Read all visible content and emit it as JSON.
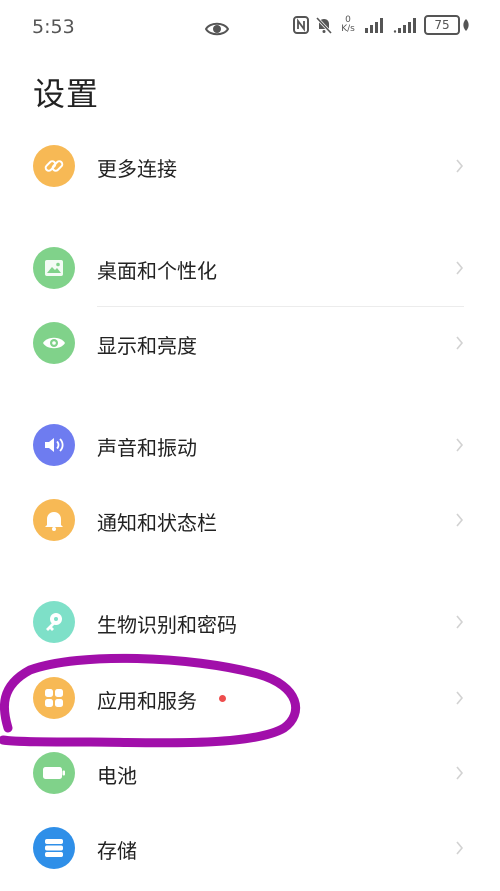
{
  "status": {
    "time": "5:53",
    "net_speed_value": "0",
    "net_speed_unit": "K/s",
    "battery_level": "75"
  },
  "page": {
    "title": "设置"
  },
  "settings": {
    "items": [
      {
        "label": "更多连接",
        "icon": "link-icon",
        "color": "#F7B955"
      },
      {
        "label": "桌面和个性化",
        "icon": "wallpaper-icon",
        "color": "#80D28A"
      },
      {
        "label": "显示和亮度",
        "icon": "eye-icon",
        "color": "#80D28A"
      },
      {
        "label": "声音和振动",
        "icon": "speaker-icon",
        "color": "#6E7CF0"
      },
      {
        "label": "通知和状态栏",
        "icon": "bell-icon",
        "color": "#F7B955"
      },
      {
        "label": "生物识别和密码",
        "icon": "key-icon",
        "color": "#7EE0C8"
      },
      {
        "label": "应用和服务",
        "icon": "apps-grid-icon",
        "color": "#F7B955",
        "badge": true
      },
      {
        "label": "电池",
        "icon": "battery-icon",
        "color": "#80D28A"
      },
      {
        "label": "存储",
        "icon": "storage-icon",
        "color": "#2F8FE8"
      }
    ]
  },
  "annotation": {
    "color": "#A10FAA"
  }
}
